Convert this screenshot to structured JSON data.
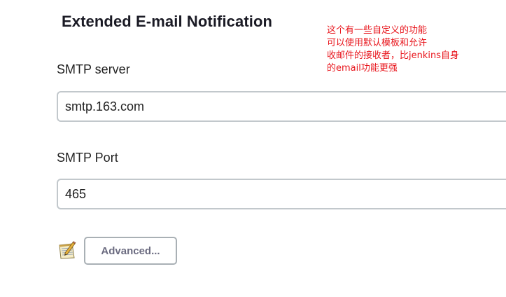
{
  "section": {
    "title": "Extended E-mail Notification"
  },
  "annotation": {
    "lines": [
      "这个有一些自定义的功能",
      "可以使用默认模板和允许",
      "收邮件的接收者，比jenkins自身",
      "的email功能更强"
    ],
    "color": "#e8141b"
  },
  "smtp_server": {
    "label": "SMTP server",
    "value": "smtp.163.com"
  },
  "smtp_port": {
    "label": "SMTP Port",
    "value": "465"
  },
  "actions": {
    "help_icon": "notepad-icon",
    "advanced_label": "Advanced..."
  }
}
